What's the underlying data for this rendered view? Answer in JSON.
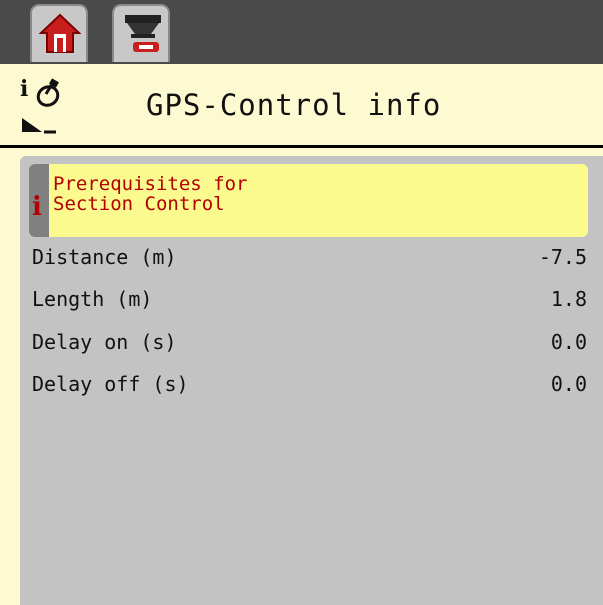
{
  "tabs": [
    {
      "icon": "home-icon"
    },
    {
      "icon": "spreader-service-icon"
    }
  ],
  "header": {
    "title": "GPS-Control info",
    "info_glyph": "i",
    "icons": [
      "info-icon",
      "gps-satellite-icon",
      "spread-boundary-icon"
    ]
  },
  "info_box": {
    "icon": "i",
    "text": "Prerequisites for\nSection Control"
  },
  "params": [
    {
      "label": "Distance (m)",
      "value": "-7.5"
    },
    {
      "label": "Length (m)",
      "value": "1.8"
    },
    {
      "label": "Delay on (s)",
      "value": "0.0"
    },
    {
      "label": "Delay off (s)",
      "value": "0.0"
    }
  ],
  "colors": {
    "top_bar": "#4a4a4a",
    "header_bg": "#fdf9d0",
    "content_bg": "#c3c3c3",
    "info_bg": "#fafa8e",
    "info_text": "#b30000",
    "home_icon": "#c81e1e"
  }
}
